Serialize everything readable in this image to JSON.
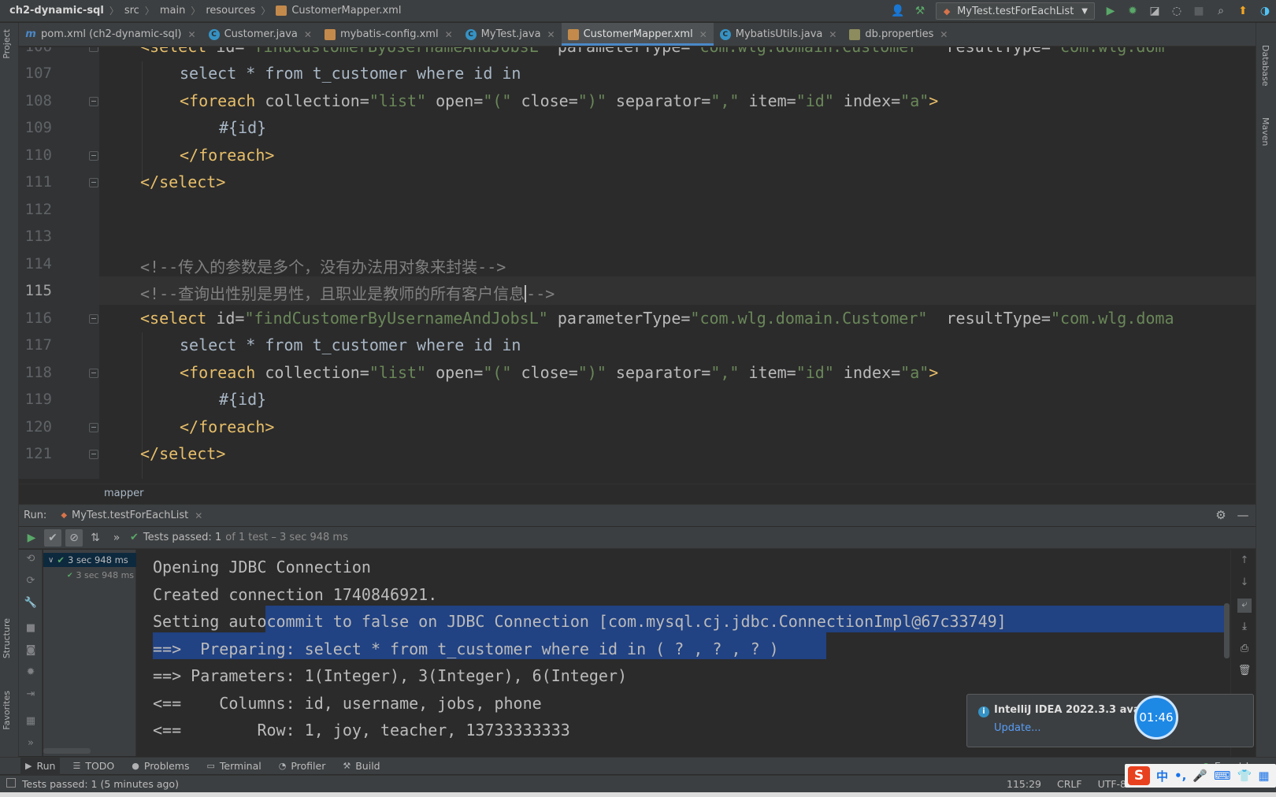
{
  "navbar": {
    "crumbs": [
      "ch2-dynamic-sql",
      "src",
      "main",
      "resources",
      "CustomerMapper.xml"
    ],
    "run_config": "MyTest.testForEachList"
  },
  "tabs": [
    {
      "label": "pom.xml (ch2-dynamic-sql)",
      "icon": "m"
    },
    {
      "label": "Customer.java",
      "icon": "c"
    },
    {
      "label": "mybatis-config.xml",
      "icon": "x"
    },
    {
      "label": "MyTest.java",
      "icon": "c"
    },
    {
      "label": "CustomerMapper.xml",
      "icon": "x"
    },
    {
      "label": "MybatisUtils.java",
      "icon": "c"
    },
    {
      "label": "db.properties",
      "icon": "p"
    }
  ],
  "left_strip": {
    "project": "Project",
    "structure": "Structure",
    "favorites": "Favorites"
  },
  "right_strip": {
    "database": "Database",
    "maven": "Maven"
  },
  "editor": {
    "line_numbers": [
      "106",
      "107",
      "108",
      "109",
      "110",
      "111",
      "112",
      "113",
      "114",
      "115",
      "116",
      "117",
      "118",
      "119",
      "120",
      "121"
    ],
    "current_line": "115",
    "l106": {
      "open": "<select",
      "id_attr": " id=",
      "id_val": "\"findCustomerByUsernameAndJobsL\"",
      "pt_attr": " parameterType=",
      "pt_val": "\"com.wlg.domain.Customer\"",
      "rt_attr": "  resultType=",
      "rt_val": "\"com.wlg.dom"
    },
    "l107": "select * from t_customer where id in",
    "l108": {
      "open": "<foreach",
      "c_attr": " collection=",
      "c_val": "\"list\"",
      "o_attr": " open=",
      "o_val": "\"(\"",
      "cl_attr": " close=",
      "cl_val": "\")\"",
      "s_attr": " separator=",
      "s_val": "\",\"",
      "i_attr": " item=",
      "i_val": "\"id\"",
      "x_attr": " index=",
      "x_val": "\"a\"",
      "end": ">"
    },
    "l109": "#{id}",
    "l110": "</foreach>",
    "l111": "</select>",
    "l114": "<!--传入的参数是多个，没有办法用对象来封装-->",
    "l115_before": "<!--查询出性别是男性，且职业是教师的所有客户信息",
    "l115_after": "-->",
    "l116": {
      "open": "<select",
      "id_attr": " id=",
      "id_val": "\"findCustomerByUsernameAndJobsL\"",
      "pt_attr": " parameterType=",
      "pt_val": "\"com.wlg.domain.Customer\"",
      "rt_attr": "  resultType=",
      "rt_val": "\"com.wlg.doma"
    },
    "l121": "</select>",
    "breadcrumb": "mapper"
  },
  "run": {
    "label": "Run:",
    "tab": "MyTest.testForEachList",
    "passed_label": "Tests passed:",
    "passed_count": "1",
    "passed_rest": "of 1 test – 3 sec 948 ms",
    "tree_root": "3 sec 948 ms",
    "tree_child": "3 sec 948 ms",
    "console": {
      "line1": "Opening JDBC Connection",
      "line2": "Created connection 1740846921.",
      "line3_a": "Setting auto",
      "line3_b": "commit to false on JDBC Connection [com.mysql.cj.jdbc.ConnectionImpl@67c33749]",
      "line4": "==>  Preparing: select * from t_customer where id in ( ? , ? , ? )",
      "line5": "==> Parameters: 1(Integer), 3(Integer), 6(Integer)",
      "line6": "<==    Columns: id, username, jobs, phone",
      "line7": "<==        Row: 1, joy, teacher, 13733333333"
    }
  },
  "notification": {
    "title": "IntelliJ IDEA 2022.3.3 availa",
    "link": "Update..."
  },
  "timer": "01:46",
  "tool_tabs": [
    "Run",
    "TODO",
    "Problems",
    "Terminal",
    "Profiler",
    "Build"
  ],
  "event_log": "Event Log",
  "status": {
    "message": "Tests passed: 1 (5 minutes ago)",
    "position": "115:29",
    "line_sep": "CRLF",
    "encoding": "UTF-8"
  },
  "ime": {
    "chars": "中"
  },
  "colors": {
    "accent": "#4a88c7",
    "selection": "#214283",
    "pass": "#59a869",
    "tag": "#e8bf6a",
    "string": "#6a8759",
    "comment": "#808080"
  }
}
